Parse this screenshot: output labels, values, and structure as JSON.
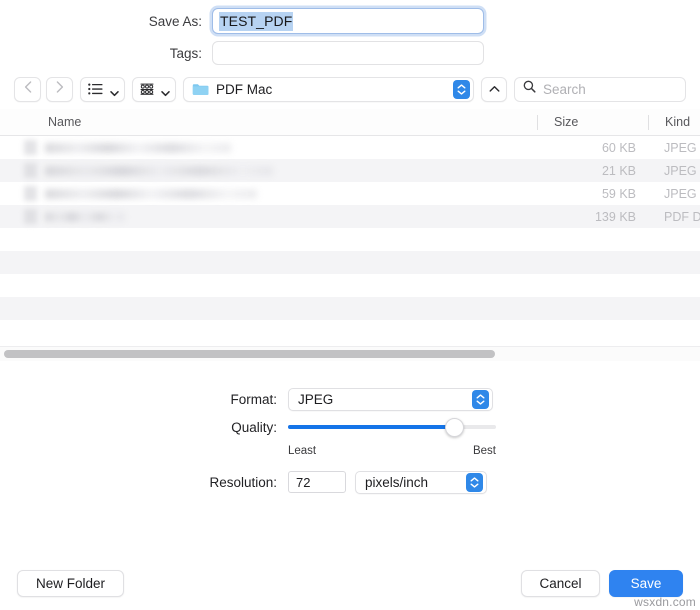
{
  "save_as": {
    "label": "Save As:",
    "value": "TEST_PDF",
    "selected": true
  },
  "tags": {
    "label": "Tags:",
    "value": "",
    "placeholder": ""
  },
  "toolbar": {
    "back_icon": "chevron-left-icon",
    "forward_icon": "chevron-right-icon",
    "list_view_icon": "list-view-icon",
    "gallery_view_icon": "gallery-view-icon",
    "path_label": "PDF Mac",
    "folder_icon": "folder-icon",
    "stepper_icon": "up-down-stepper-icon",
    "up_icon": "chevron-up-icon",
    "search_icon": "search-icon",
    "search_placeholder": "Search",
    "search_value": ""
  },
  "file_list": {
    "columns": [
      "Name",
      "Size",
      "Kind"
    ],
    "rows": [
      {
        "name": "",
        "size": "60 KB",
        "kind": "JPEG i"
      },
      {
        "name": "",
        "size": "21 KB",
        "kind": "JPEG i"
      },
      {
        "name": "",
        "size": "59 KB",
        "kind": "JPEG i"
      },
      {
        "name": "",
        "size": "139 KB",
        "kind": "PDF Do"
      }
    ],
    "scrollbar": {
      "orientation": "horizontal",
      "thumb_width_pct": 71
    }
  },
  "options": {
    "format": {
      "label": "Format:",
      "value": "JPEG"
    },
    "quality": {
      "label": "Quality:",
      "least_label": "Least",
      "best_label": "Best",
      "value_pct": 80
    },
    "resolution": {
      "label": "Resolution:",
      "value": "72",
      "unit": "pixels/inch"
    }
  },
  "footer": {
    "new_folder_label": "New Folder",
    "cancel_label": "Cancel",
    "save_label": "Save"
  },
  "watermark": "wsxdn.com",
  "colors": {
    "accent_blue": "#2f83f0",
    "slider_blue": "#1574e8",
    "stepper_blue": "#2f88e8",
    "selection_blue": "#b7d3f2",
    "focus_ring": "#9fbde8",
    "folder_blue": "#7ec8ef",
    "row_alt": "#f4f4f6"
  }
}
